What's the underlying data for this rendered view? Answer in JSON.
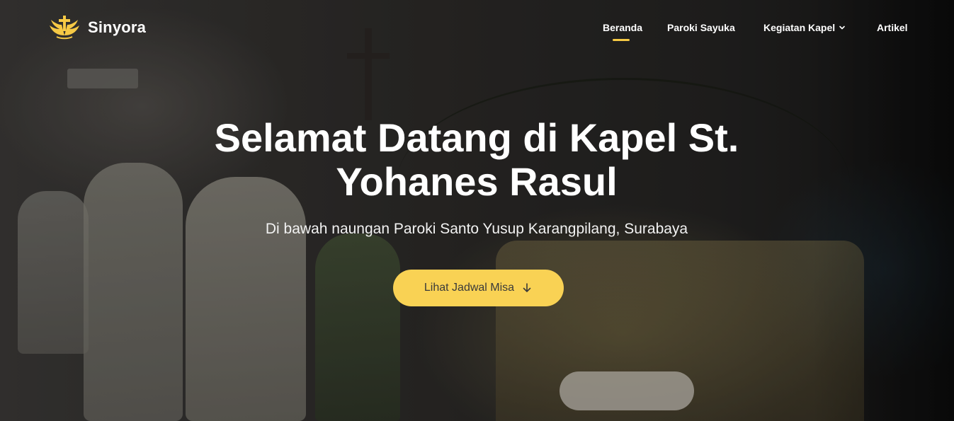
{
  "brand": {
    "name": "Sinyora",
    "logo_icon": "cross-wings-logo-icon",
    "logo_color": "#f6c945"
  },
  "nav": {
    "items": [
      {
        "label": "Beranda",
        "active": true
      },
      {
        "label": "Paroki Sayuka",
        "active": false
      },
      {
        "label": "Kegiatan Kapel",
        "active": false,
        "has_dropdown": true
      },
      {
        "label": "Artikel",
        "active": false
      }
    ],
    "active_indicator_color": "#f6c945"
  },
  "hero": {
    "title_line1": "Selamat Datang di Kapel St.",
    "title_line2": "Yohanes Rasul",
    "subtitle": "Di bawah naungan Paroki Santo Yusup Karangpilang, Surabaya",
    "cta_label": "Lihat Jadwal Misa",
    "cta_icon": "arrow-down-icon",
    "cta_color": "#f9d254"
  }
}
